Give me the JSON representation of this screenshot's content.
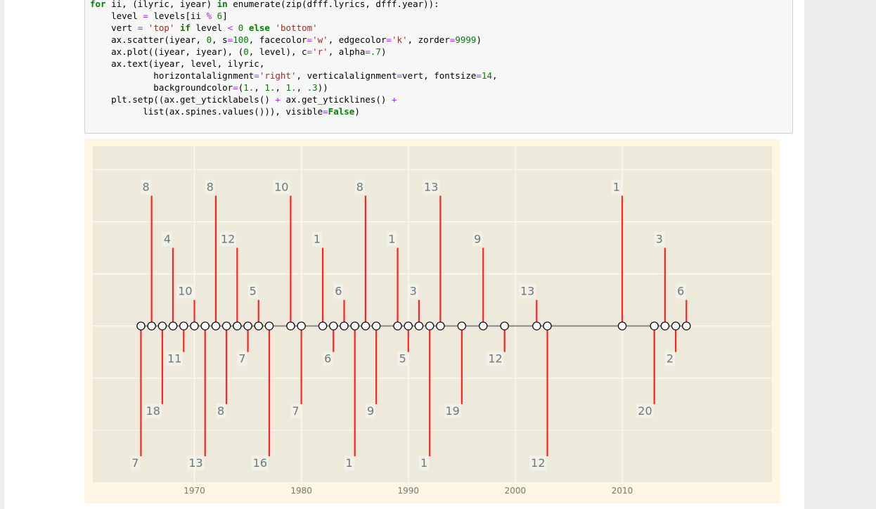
{
  "code_lines": [
    [
      [
        "for",
        "kw"
      ],
      [
        " ii, (ilyric, iyear) ",
        ""
      ],
      [
        "in",
        "kw"
      ],
      [
        " enumerate(zip(dfff.lyrics, dfff.year)):",
        ""
      ]
    ],
    [
      [
        "    level ",
        ""
      ],
      [
        "=",
        "op"
      ],
      [
        " levels[ii ",
        ""
      ],
      [
        "%",
        "op"
      ],
      [
        " ",
        ""
      ],
      [
        "6",
        "nu"
      ],
      [
        "]",
        ""
      ]
    ],
    [
      [
        "    vert ",
        ""
      ],
      [
        "=",
        "op"
      ],
      [
        " ",
        ""
      ],
      [
        "'top'",
        "st"
      ],
      [
        " ",
        ""
      ],
      [
        "if",
        "kw"
      ],
      [
        " level ",
        ""
      ],
      [
        "<",
        "op"
      ],
      [
        " ",
        ""
      ],
      [
        "0",
        "nu"
      ],
      [
        " ",
        ""
      ],
      [
        "else",
        "kw"
      ],
      [
        " ",
        ""
      ],
      [
        "'bottom'",
        "st"
      ]
    ],
    [
      [
        "    ax.scatter(iyear, ",
        ""
      ],
      [
        "0",
        "nu"
      ],
      [
        ", s",
        ""
      ],
      [
        "=",
        "op"
      ],
      [
        "100",
        "nu"
      ],
      [
        ", facecolor",
        ""
      ],
      [
        "=",
        "op"
      ],
      [
        "'w'",
        "st"
      ],
      [
        ", edgecolor",
        ""
      ],
      [
        "=",
        "op"
      ],
      [
        "'k'",
        "st"
      ],
      [
        ", zorder",
        ""
      ],
      [
        "=",
        "op"
      ],
      [
        "9999",
        "nu"
      ],
      [
        ")",
        ""
      ]
    ],
    [
      [
        "    ax.plot((iyear, iyear), (",
        ""
      ],
      [
        "0",
        "nu"
      ],
      [
        ", level), c",
        ""
      ],
      [
        "=",
        "op"
      ],
      [
        "'r'",
        "st"
      ],
      [
        ", alpha",
        ""
      ],
      [
        "=",
        "op"
      ],
      [
        ".7",
        "nu"
      ],
      [
        ")",
        ""
      ]
    ],
    [
      [
        "    ax.text(iyear, level, ilyric,",
        ""
      ]
    ],
    [
      [
        "            horizontalalignment",
        ""
      ],
      [
        "=",
        "op"
      ],
      [
        "'right'",
        "st"
      ],
      [
        ", verticalalignment",
        ""
      ],
      [
        "=",
        "op"
      ],
      [
        "vert, fontsize",
        ""
      ],
      [
        "=",
        "op"
      ],
      [
        "14",
        "nu"
      ],
      [
        ",",
        ""
      ]
    ],
    [
      [
        "            backgroundcolor",
        ""
      ],
      [
        "=",
        "op"
      ],
      [
        "(",
        ""
      ],
      [
        "1.",
        "nu"
      ],
      [
        ", ",
        ""
      ],
      [
        "1.",
        "nu"
      ],
      [
        ", ",
        ""
      ],
      [
        "1.",
        "nu"
      ],
      [
        ", ",
        ""
      ],
      [
        ".3",
        "nu"
      ],
      [
        "))",
        ""
      ]
    ],
    [
      [
        "    plt.setp((ax.get_yticklabels() ",
        ""
      ],
      [
        "+",
        "op"
      ],
      [
        " ax.get_yticklines() ",
        ""
      ],
      [
        "+",
        "op"
      ]
    ],
    [
      [
        "          list(ax.spines.values())), visible",
        ""
      ],
      [
        "=",
        "op"
      ],
      [
        "False",
        "kw"
      ],
      [
        ")",
        ""
      ]
    ]
  ],
  "colors": {
    "figure_bg": "#fdf6e3",
    "axes_bg": "#eeeadb",
    "grid": "#fbf8ef",
    "stem": "#ff0000",
    "baseline": "#8a8a82",
    "marker_face": "#ffffff",
    "marker_edge": "#000000",
    "label_text": "#657b83",
    "label_bg": "#ffffff"
  },
  "chart_data": {
    "type": "timeline",
    "title": "",
    "xlabel": "",
    "ylabel": "",
    "xlim": [
      1960.5,
      2024
    ],
    "ylim": [
      -6,
      6.9
    ],
    "xticks": [
      1970,
      1980,
      1990,
      2000,
      2010
    ],
    "grid": true,
    "points": [
      {
        "year": 1965,
        "level": -5,
        "label": "7"
      },
      {
        "year": 1966,
        "level": 5,
        "label": "8"
      },
      {
        "year": 1967,
        "level": -3,
        "label": "18"
      },
      {
        "year": 1968,
        "level": 3,
        "label": "4"
      },
      {
        "year": 1969,
        "level": -1,
        "label": "11"
      },
      {
        "year": 1970,
        "level": 1,
        "label": "10"
      },
      {
        "year": 1971,
        "level": -5,
        "label": "13"
      },
      {
        "year": 1972,
        "level": 5,
        "label": "8"
      },
      {
        "year": 1973,
        "level": -3,
        "label": "8"
      },
      {
        "year": 1974,
        "level": 3,
        "label": "12"
      },
      {
        "year": 1975,
        "level": -1,
        "label": "7"
      },
      {
        "year": 1976,
        "level": 1,
        "label": "5"
      },
      {
        "year": 1977,
        "level": -5,
        "label": "16"
      },
      {
        "year": 1979,
        "level": 5,
        "label": "10"
      },
      {
        "year": 1980,
        "level": -3,
        "label": "7"
      },
      {
        "year": 1982,
        "level": 3,
        "label": "1"
      },
      {
        "year": 1983,
        "level": -1,
        "label": "6"
      },
      {
        "year": 1984,
        "level": 1,
        "label": "6"
      },
      {
        "year": 1985,
        "level": -5,
        "label": "1"
      },
      {
        "year": 1986,
        "level": 5,
        "label": "8"
      },
      {
        "year": 1987,
        "level": -3,
        "label": "9"
      },
      {
        "year": 1989,
        "level": 3,
        "label": "1"
      },
      {
        "year": 1990,
        "level": -1,
        "label": "5"
      },
      {
        "year": 1991,
        "level": 1,
        "label": "3"
      },
      {
        "year": 1992,
        "level": -5,
        "label": "1"
      },
      {
        "year": 1993,
        "level": 5,
        "label": "13"
      },
      {
        "year": 1995,
        "level": -3,
        "label": "19"
      },
      {
        "year": 1997,
        "level": 3,
        "label": "9"
      },
      {
        "year": 1999,
        "level": -1,
        "label": "12"
      },
      {
        "year": 2002,
        "level": 1,
        "label": "13"
      },
      {
        "year": 2003,
        "level": -5,
        "label": "12"
      },
      {
        "year": 2010,
        "level": 5,
        "label": "1"
      },
      {
        "year": 2013,
        "level": -3,
        "label": "20"
      },
      {
        "year": 2014,
        "level": 3,
        "label": "3"
      },
      {
        "year": 2015,
        "level": -1,
        "label": "2"
      },
      {
        "year": 2016,
        "level": 1,
        "label": "6"
      }
    ]
  }
}
